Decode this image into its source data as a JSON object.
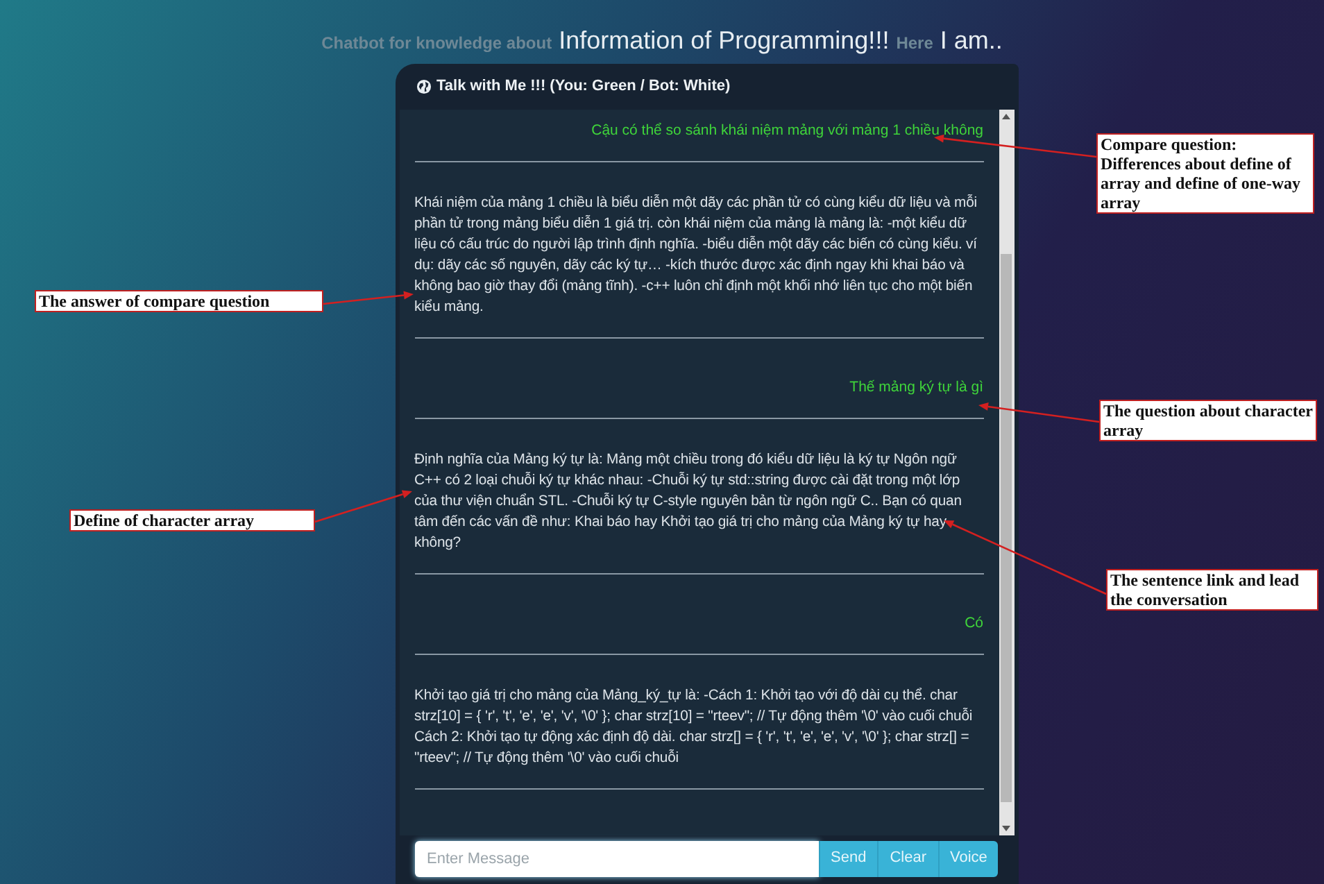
{
  "title": {
    "muted_prefix": "Chatbot for knowledge about",
    "main": "Information of Programming!!!",
    "muted_middle": "Here",
    "suffix": "I am.."
  },
  "chat": {
    "header": "Talk with Me !!! (You: Green / Bot: White)",
    "messages": [
      {
        "kind": "user",
        "text": "Cậu có thể so sánh khái niệm mảng với mảng 1 chiều không"
      },
      {
        "kind": "bot",
        "text": "Khái niệm của mảng 1 chiều là biểu diễn một dãy các phần tử có cùng kiểu dữ liệu và mỗi phần tử trong mảng biểu diễn 1 giá trị. còn khái niệm của mảng là mảng là: -một kiểu dữ liệu có cấu trúc do người lập trình định nghĩa. -biểu diễn một dãy các biến có cùng kiểu. ví dụ: dãy các số nguyên, dãy các ký tự… -kích thước được xác định ngay khi khai báo và không bao giờ thay đổi (mảng tĩnh). -c++ luôn chỉ định một khối nhớ liên tục cho một biến kiểu mảng."
      },
      {
        "kind": "user",
        "text": "Thế mảng ký tự là gì"
      },
      {
        "kind": "bot",
        "text": "Định nghĩa của Mảng ký tự là: Mảng một chiều trong đó kiểu dữ liệu là ký tự Ngôn ngữ C++ có 2 loại chuỗi ký tự khác nhau: -Chuỗi ký tự std::string được cài đặt trong một lớp của thư viện chuẩn STL. -Chuỗi ký tự C-style nguyên bản từ ngôn ngữ C.. Bạn có quan tâm đến các vấn đề như: Khai báo hay Khởi tạo giá trị cho mảng của Mảng ký tự hay không?"
      },
      {
        "kind": "user",
        "text": "Có"
      },
      {
        "kind": "bot",
        "text": "Khởi tạo giá trị cho mảng của Mảng_ký_tự là: -Cách 1: Khởi tạo với độ dài cụ thể. char strz[10] = { 'r', 't', 'e', 'e', 'v', '\\0' }; char strz[10] = \"rteev\"; // Tự động thêm '\\0' vào cuối chuỗi Cách 2: Khởi tạo tự động xác định độ dài. char strz[] = { 'r', 't', 'e', 'e', 'v', '\\0' }; char strz[] = \"rteev\"; // Tự động thêm '\\0' vào cuối chuỗi"
      }
    ],
    "input": {
      "placeholder": "Enter Message"
    },
    "buttons": [
      "Send",
      "Clear",
      "Voice"
    ]
  },
  "annotations": [
    {
      "text": "Compare question: Differences about define of array and define of one-way array"
    },
    {
      "text": "The answer of compare question"
    },
    {
      "text": "The question about character array"
    },
    {
      "text": "Define of character array"
    },
    {
      "text": "The sentence link and lead the conversation"
    }
  ]
}
